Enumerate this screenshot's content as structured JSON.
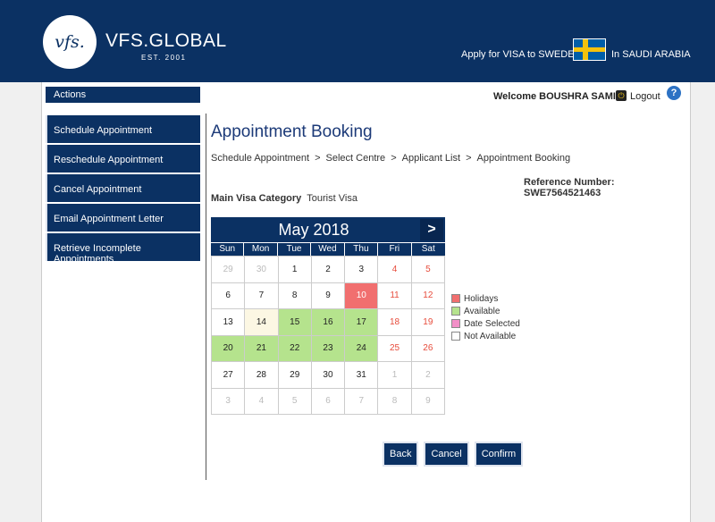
{
  "header": {
    "logo_text": "vfs.",
    "brand": "VFS.GLOBAL",
    "est": "EST. 2001",
    "apply_text": "Apply for VISA to SWEDEN",
    "country_text": "In SAUDI ARABIA"
  },
  "sidebar": {
    "actions_label": "Actions",
    "items": [
      {
        "label": "Schedule Appointment"
      },
      {
        "label": "Reschedule Appointment"
      },
      {
        "label": "Cancel Appointment"
      },
      {
        "label": "Email Appointment Letter"
      },
      {
        "label": "Retrieve Incomplete Appointments"
      }
    ]
  },
  "topbar": {
    "welcome": "Welcome BOUSHRA SAMI !",
    "logout": "Logout",
    "help": "?"
  },
  "main": {
    "title": "Appointment Booking",
    "breadcrumb": [
      "Schedule Appointment",
      "Select Centre",
      "Applicant List",
      "Appointment Booking"
    ],
    "breadcrumb_sep": ">",
    "reference": "Reference Number: SWE7564521463",
    "visa_label": "Main Visa Category",
    "visa_value": "Tourist Visa"
  },
  "calendar": {
    "month_label": "May 2018",
    "next_icon": ">",
    "weekdays": [
      "Sun",
      "Mon",
      "Tue",
      "Wed",
      "Thu",
      "Fri",
      "Sat"
    ],
    "weeks": [
      [
        [
          "29",
          "other"
        ],
        [
          "30",
          "other"
        ],
        [
          "1",
          ""
        ],
        [
          "2",
          ""
        ],
        [
          "3",
          ""
        ],
        [
          "4",
          "weekend"
        ],
        [
          "5",
          "weekend"
        ]
      ],
      [
        [
          "6",
          ""
        ],
        [
          "7",
          ""
        ],
        [
          "8",
          ""
        ],
        [
          "9",
          ""
        ],
        [
          "10",
          "holiday"
        ],
        [
          "11",
          "weekend"
        ],
        [
          "12",
          "weekend"
        ]
      ],
      [
        [
          "13",
          ""
        ],
        [
          "14",
          "today"
        ],
        [
          "15",
          "available"
        ],
        [
          "16",
          "available"
        ],
        [
          "17",
          "available"
        ],
        [
          "18",
          "weekend"
        ],
        [
          "19",
          "weekend"
        ]
      ],
      [
        [
          "20",
          "available"
        ],
        [
          "21",
          "available"
        ],
        [
          "22",
          "available"
        ],
        [
          "23",
          "available"
        ],
        [
          "24",
          "available"
        ],
        [
          "25",
          "weekend"
        ],
        [
          "26",
          "weekend"
        ]
      ],
      [
        [
          "27",
          ""
        ],
        [
          "28",
          ""
        ],
        [
          "29",
          ""
        ],
        [
          "30",
          ""
        ],
        [
          "31",
          ""
        ],
        [
          "1",
          "other"
        ],
        [
          "2",
          "other"
        ]
      ],
      [
        [
          "3",
          "other"
        ],
        [
          "4",
          "other"
        ],
        [
          "5",
          "other"
        ],
        [
          "6",
          "other"
        ],
        [
          "7",
          "other"
        ],
        [
          "8",
          "other"
        ],
        [
          "9",
          "other"
        ]
      ]
    ]
  },
  "legend": [
    {
      "label": "Holidays",
      "color": "#f16f6f"
    },
    {
      "label": "Available",
      "color": "#b5e38d"
    },
    {
      "label": "Date Selected",
      "color": "#f28fc7"
    },
    {
      "label": "Not Available",
      "color": "#ffffff"
    }
  ],
  "buttons": {
    "back": "Back",
    "cancel": "Cancel",
    "confirm": "Confirm"
  }
}
